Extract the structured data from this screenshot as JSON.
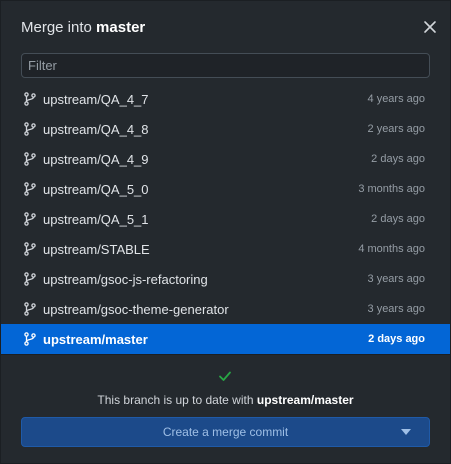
{
  "header": {
    "title_prefix": "Merge into",
    "branch": "master"
  },
  "filter": {
    "placeholder": "Filter",
    "value": ""
  },
  "branches": [
    {
      "name": "upstream/QA_4_7",
      "age": "4 years ago"
    },
    {
      "name": "upstream/QA_4_8",
      "age": "2 years ago"
    },
    {
      "name": "upstream/QA_4_9",
      "age": "2 days ago"
    },
    {
      "name": "upstream/QA_5_0",
      "age": "3 months ago"
    },
    {
      "name": "upstream/QA_5_1",
      "age": "2 days ago"
    },
    {
      "name": "upstream/STABLE",
      "age": "4 months ago"
    },
    {
      "name": "upstream/gsoc-js-refactoring",
      "age": "3 years ago"
    },
    {
      "name": "upstream/gsoc-theme-generator",
      "age": "3 years ago"
    },
    {
      "name": "upstream/master",
      "age": "2 days ago"
    }
  ],
  "selected_branch_index": 8,
  "status": {
    "prefix": "This branch is up to date with",
    "branch": "upstream/master"
  },
  "merge_button": {
    "label": "Create a merge commit"
  },
  "colors": {
    "background": "#24292e",
    "selected": "#0366d6",
    "success": "#28a745",
    "button": "#1c4a8a"
  },
  "icons": {
    "branch": "git-branch-icon",
    "close": "close-icon",
    "check": "check-icon",
    "caret": "caret-down-icon"
  }
}
